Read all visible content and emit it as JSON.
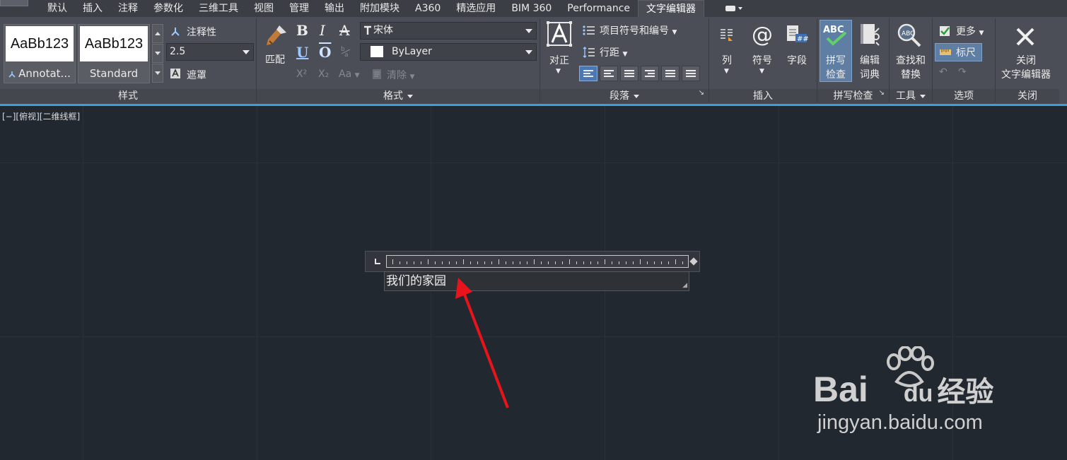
{
  "tabs": [
    "默认",
    "插入",
    "注释",
    "参数化",
    "三维工具",
    "视图",
    "管理",
    "输出",
    "附加模块",
    "A360",
    "精选应用",
    "BIM 360",
    "Performance",
    "文字编辑器"
  ],
  "active_tab": "文字编辑器",
  "style_panel": {
    "title": "样式",
    "swatch1_preview": "AaBb123",
    "swatch1_name": "Annotat...",
    "swatch2_preview": "AaBb123",
    "swatch2_name": "Standard",
    "annotative_label": "注释性",
    "text_height": "2.5",
    "mask_label": "遮罩"
  },
  "format_panel": {
    "title": "格式",
    "match_label": "匹配",
    "font_value": "宋体",
    "color_value": "ByLayer",
    "bold": "B",
    "italic": "I",
    "strike": "A",
    "underline": "U",
    "overline": "O",
    "superscript": "X²",
    "subscript": "X₂",
    "case": "Aa",
    "clear_label": "清除"
  },
  "paragraph_panel": {
    "title": "段落",
    "justify_label": "对正",
    "bullets_label": "项目符号和编号",
    "line_spacing_label": "行距"
  },
  "insert_panel": {
    "title": "插入",
    "columns_label": "列",
    "symbol_label": "符号",
    "field_label": "字段"
  },
  "spell_panel": {
    "title": "拼写检查",
    "spell_check_label": "拼写\n检查",
    "dictionary_label": "编辑\n词典",
    "spell_line1": "拼写",
    "spell_line2": "检查",
    "dict_line1": "编辑",
    "dict_line2": "词典"
  },
  "tools_panel": {
    "title": "工具",
    "find_line1": "查找和",
    "find_line2": "替换"
  },
  "options_panel": {
    "title": "选项",
    "more_label": "更多",
    "ruler_label": "标尺"
  },
  "close_panel": {
    "title": "关闭",
    "close_line1": "关闭",
    "close_line2": "文字编辑器"
  },
  "viewport_label": "[−][俯视][二维线框]",
  "editor_text": "我们的家园",
  "watermark": {
    "brand": "Bai",
    "brand_du": "du",
    "brand_cn": "经验",
    "url": "jingyan.baidu.com"
  },
  "colors": {
    "ribbon_bg": "#4b4e56",
    "canvas_bg": "#212830",
    "accent_blue": "#3aa0e0",
    "arrow_red": "#e8141c"
  }
}
